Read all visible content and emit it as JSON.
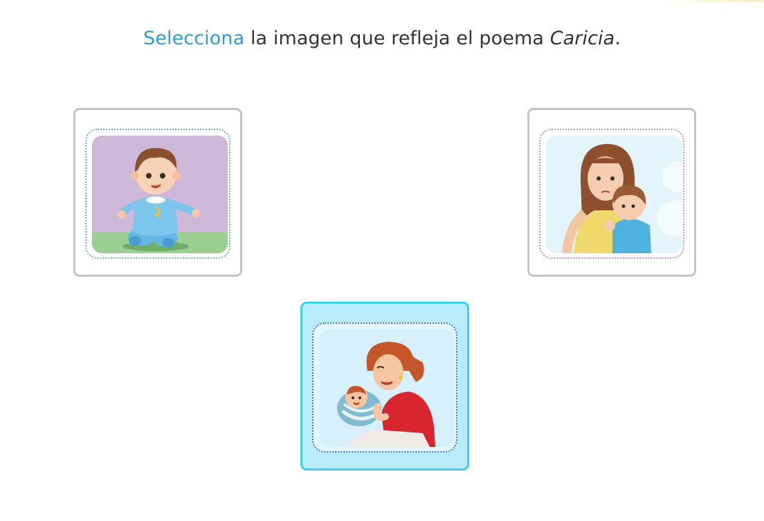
{
  "instruction": {
    "verb": "Selecciona",
    "middle": " la imagen que refleja el poema ",
    "poem_title": "Caricia",
    "end": "."
  },
  "colors": {
    "accent": "#2a9fd6",
    "card_border": "#c4c4c4",
    "selected_border": "#3fcfee",
    "selected_background": "#b8ebfb"
  },
  "options": [
    {
      "picture": "baby-sitting-illustration",
      "selected": false
    },
    {
      "picture": "mother-hugging-child-illustration",
      "selected": false
    },
    {
      "picture": "mother-holding-baby-illustration",
      "selected": true
    }
  ]
}
